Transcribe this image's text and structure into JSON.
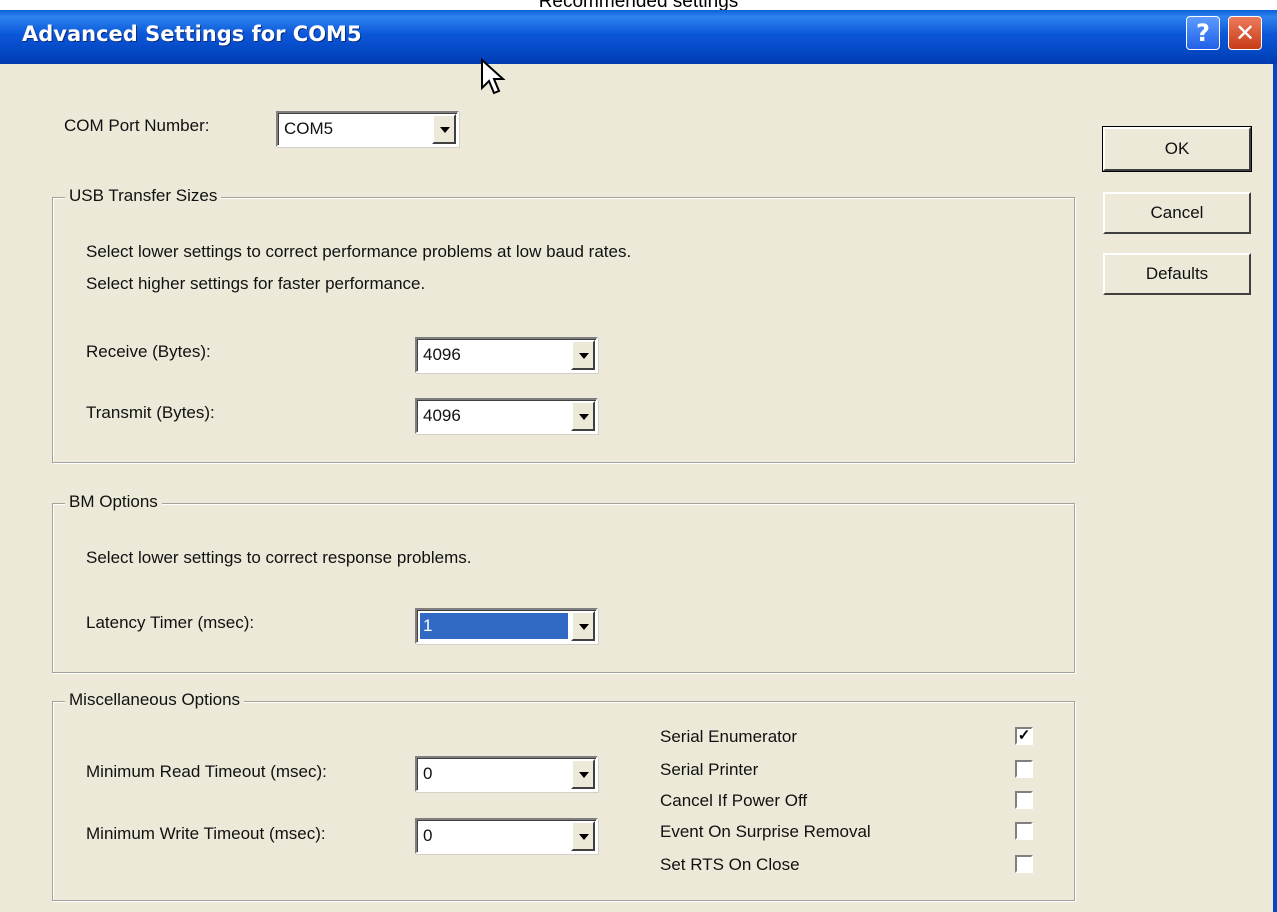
{
  "caption": "Recommended settings",
  "window": {
    "title": "Advanced Settings for COM5",
    "help_glyph": "?",
    "close_glyph": "✕"
  },
  "com_port": {
    "label": "COM Port Number:",
    "value": "COM5"
  },
  "usb_transfer": {
    "legend": "USB Transfer Sizes",
    "desc1": "Select lower settings to correct performance problems at low baud rates.",
    "desc2": "Select higher settings for faster performance.",
    "receive_label": "Receive (Bytes):",
    "receive_value": "4096",
    "transmit_label": "Transmit (Bytes):",
    "transmit_value": "4096"
  },
  "bm_options": {
    "legend": "BM Options",
    "desc": "Select lower settings to correct response problems.",
    "latency_label": "Latency Timer (msec):",
    "latency_value": "1"
  },
  "misc_options": {
    "legend": "Miscellaneous Options",
    "min_read_label": "Minimum Read Timeout (msec):",
    "min_read_value": "0",
    "min_write_label": "Minimum Write Timeout (msec):",
    "min_write_value": "0",
    "checks": [
      {
        "label": "Serial Enumerator",
        "checked": true,
        "mark": "✓"
      },
      {
        "label": "Serial Printer",
        "checked": false,
        "mark": ""
      },
      {
        "label": "Cancel If Power Off",
        "checked": false,
        "mark": ""
      },
      {
        "label": "Event On Surprise Removal",
        "checked": false,
        "mark": ""
      },
      {
        "label": "Set RTS On Close",
        "checked": false,
        "mark": ""
      }
    ]
  },
  "buttons": {
    "ok": "OK",
    "cancel": "Cancel",
    "defaults": "Defaults"
  },
  "colors": {
    "titlebar": "#0b57d9",
    "dialog_bg": "#ece9d8",
    "selection": "#316ac5"
  }
}
